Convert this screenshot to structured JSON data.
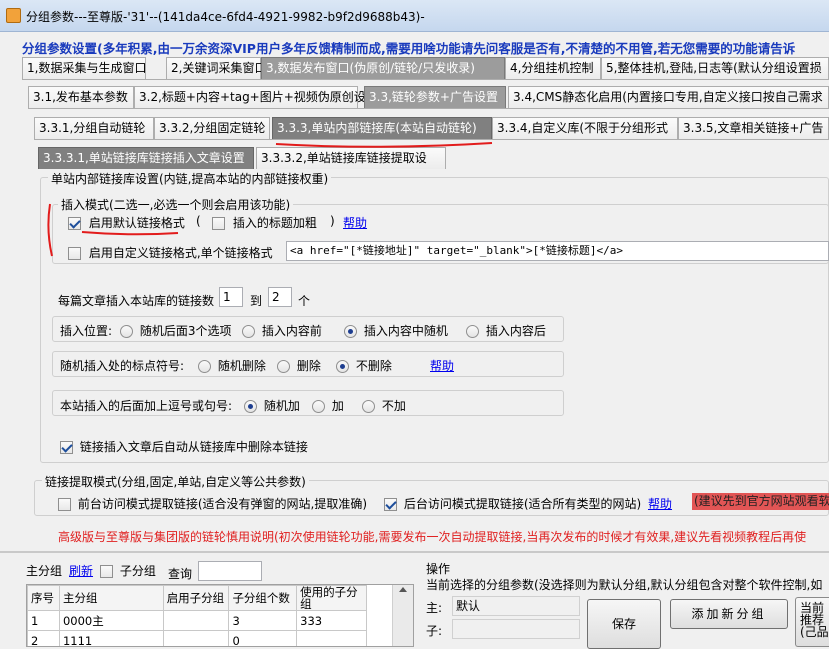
{
  "window": {
    "title": "分组参数---至尊版-'31'--(141da4ce-6fd4-4921-9982-b9f2d9688b43)-"
  },
  "banner": "分组参数设置(多年积累,由一万余资深VIP用户多年反馈精制而成,需要用啥功能请先问客服是否有,不清楚的不用管,若无您需要的功能请告诉",
  "tabs_level1": [
    "1,数据采集与生成窗口",
    "2,关键词采集窗口",
    "3,数据发布窗口(伪原创/链轮/只发收录)",
    "4,分组挂机控制",
    "5,整体挂机,登陆,日志等(默认分组设置损"
  ],
  "tabs_level2": [
    "3.1,发布基本参数",
    "3.2,标题+内容+tag+图片+视频伪原创设",
    "3.3,链轮参数+广告设置",
    "3.4,CMS静态化启用(内置接口专用,自定义接口按自己需求"
  ],
  "tabs_level3": [
    "3.3.1,分组自动链轮",
    "3.3.2,分组固定链轮",
    "3.3.3,单站内部链接库(本站自动链轮)",
    "3.3.4,自定义库(不限于分组形式",
    "3.3.5,文章相关链接+广告"
  ],
  "tabs_level4": [
    "3.3.3.1,单站链接库链接插入文章设置",
    "3.3.3.2,单站链接库链接提取设"
  ],
  "settings": {
    "group_title": "单站内部链接库设置(内链,提高本站的内部链接权重)",
    "insert_mode_title": "插入模式(二选一,必选一个则会启用该功能)",
    "default_format_label": "启用默认链接格式",
    "paren_open": "(",
    "insert_title_bold_label": "插入的标题加粗",
    "paren_close": ")",
    "help1": "帮助",
    "custom_format_label": "启用自定义链接格式,单个链接格式",
    "custom_format_value": "<a href=\"[*链接地址]\" target=\"_blank\">[*链接标题]</a>",
    "links_per_article_label": "每篇文章插入本站库的链接数",
    "links_min": "1",
    "links_to": "到",
    "links_max": "2",
    "links_unit": "个",
    "position_label": "插入位置:",
    "position_options": [
      "随机后面3个选项",
      "插入内容前",
      "插入内容中随机",
      "插入内容后"
    ],
    "punct_label": "随机插入处的标点符号:",
    "punct_options": [
      "随机删除",
      "删除",
      "不删除"
    ],
    "help2": "帮助",
    "comma_label": "本站插入的后面加上逗号或句号:",
    "comma_options": [
      "随机加",
      "加",
      "不加"
    ],
    "auto_delete_label": "链接插入文章后自动从链接库中删除本链接"
  },
  "extract": {
    "title": "链接提取模式(分组,固定,单站,自定义等公共参数)",
    "frontend_label": "前台访问模式提取链接(适合没有弹窗的网站,提取准确)",
    "backend_label": "后台访问模式提取链接(适合所有类型的网站)",
    "help": "帮助",
    "notice_red": "(建议先到官方网站观看软",
    "warning": "高级版与至尊版与集团版的链轮慎用说明(初次使用链轮功能,需要发布一次自动提取链接,当再次发布的时候才有效果,建议先看视频教程后再使"
  },
  "group_panel": {
    "label": "主分组",
    "refresh": "刷新",
    "sub_label": "子分组",
    "query_label": "查询",
    "columns": [
      "序号",
      "主分组",
      "启用子分组",
      "子分组个数",
      "使用的子分组"
    ],
    "rows": [
      [
        "1",
        "0000主",
        "",
        "3",
        "333"
      ],
      [
        "2",
        "1111",
        "",
        "0",
        ""
      ]
    ]
  },
  "ops": {
    "title": "操作",
    "desc": "当前选择的分组参数(没选择则为默认分组,默认分组包含对整个软件控制,如",
    "main_label": "主:",
    "main_value": "默认",
    "sub_label": "子:",
    "save": "保存",
    "add_group": "添加新分组",
    "right_cut1": "当前",
    "right_cut2": "推荐",
    "right_cut3": "(己品"
  }
}
